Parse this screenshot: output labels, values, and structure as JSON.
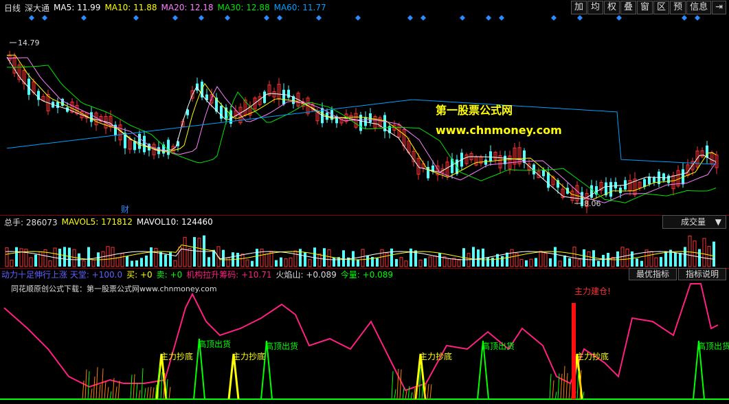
{
  "topbar": {
    "period": "日线",
    "stock": "深大通",
    "ma5": "MA5: 11.99",
    "ma10": "MA10: 11.88",
    "ma20": "MA20: 12.18",
    "ma30": "MA30: 12.88",
    "ma60": "MA60: 11.77"
  },
  "toolbar": [
    "加",
    "均",
    "权",
    "叠",
    "窗",
    "区",
    "预",
    "信息",
    "⇥"
  ],
  "price_marks": {
    "high": "14.79",
    "low": "8.06",
    "cai": "财"
  },
  "watermark": {
    "line1": "第一股票公式网",
    "line2": "www.chnmoney.com"
  },
  "volume": {
    "total": "总手: 286073",
    "mavol5": "MAVOL5: 171812",
    "mavol10": "MAVOL10: 124460",
    "select": "成交量",
    "arrow": "▼"
  },
  "indicator": {
    "t1": "动力十足伸行上涨 天堂: +100.0",
    "t2": "买: +0",
    "t3": "卖: +0",
    "t4": "机构拉升筹码: +10.71",
    "t5": "火焰山: +0.089",
    "t6": "今量: +0.089",
    "btn1": "最优指标",
    "btn2": "指标说明",
    "title": "同花顺原创公式下载：第一股票公式网www.chnmoney.com",
    "labels": {
      "jc": "主力建仓!",
      "cd": "主力抄底",
      "gd": "高顶出货"
    }
  },
  "colors": {
    "up": "#ff3232",
    "down": "#54ffff",
    "ma5": "#ffffff",
    "ma10": "#ffff00",
    "ma20": "#ff80ff",
    "ma30": "#00e600",
    "ma60": "#00a0ff",
    "pink": "#ff2080",
    "green": "#00ff00",
    "yellow": "#ffff00"
  }
}
